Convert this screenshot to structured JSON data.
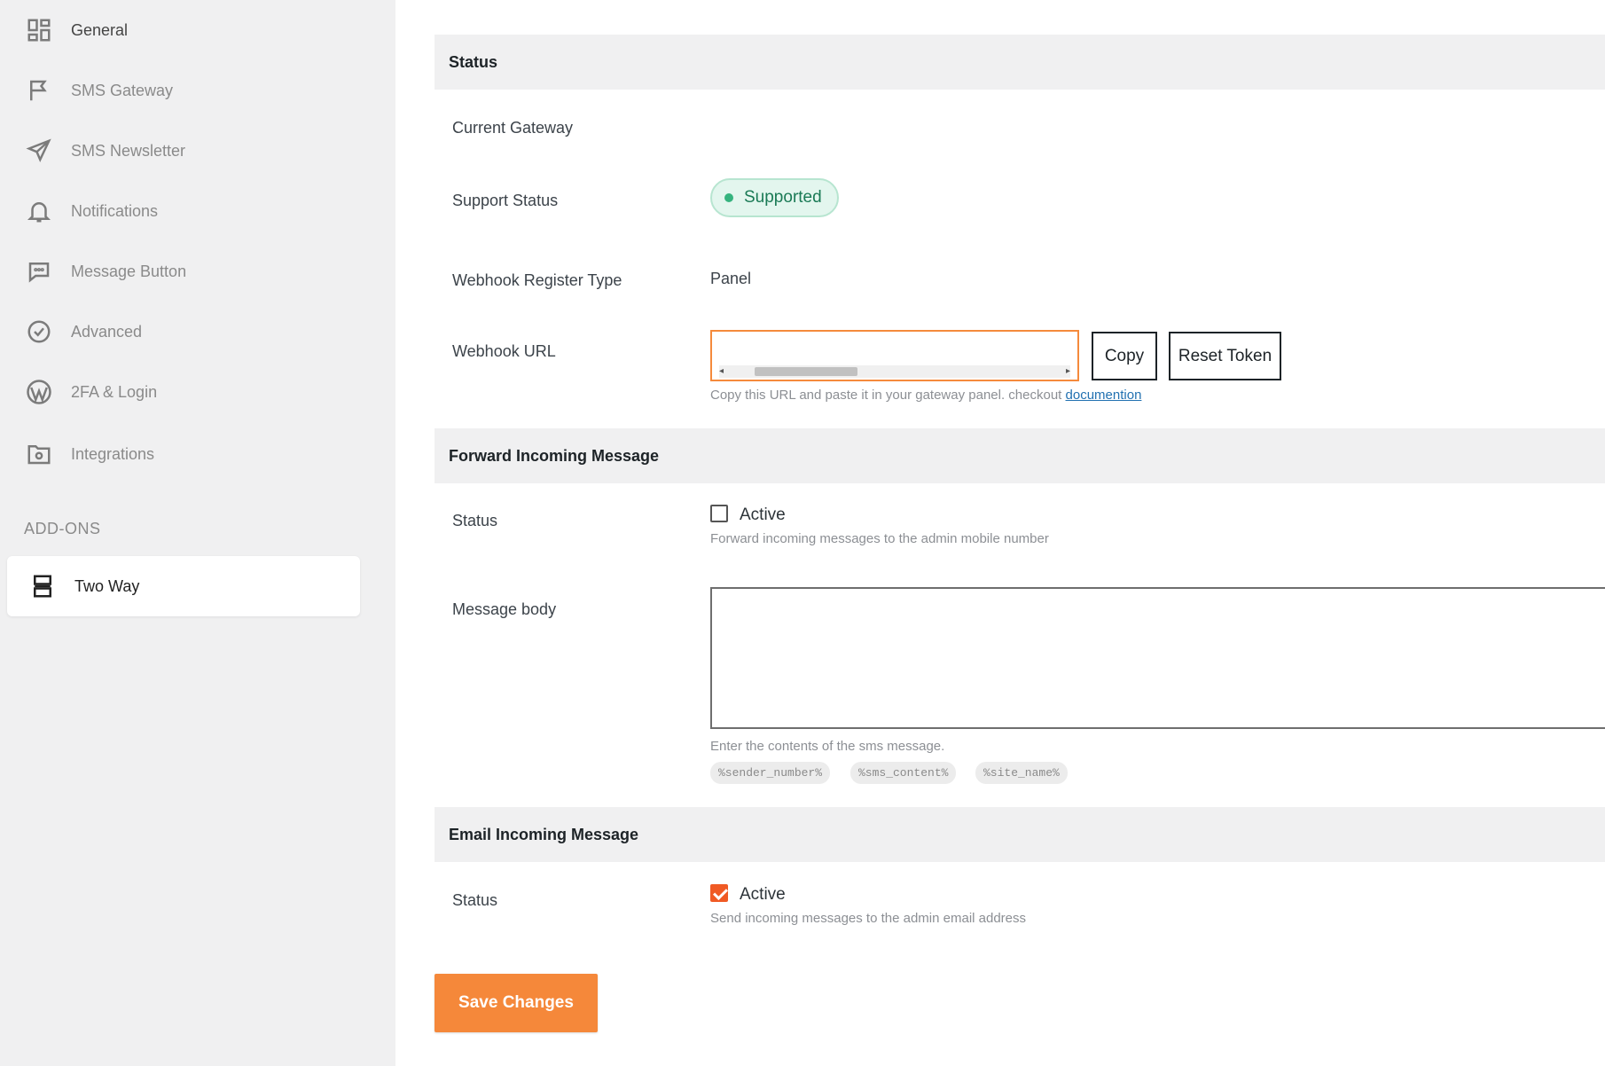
{
  "sidebar": {
    "items": [
      {
        "label": "General",
        "icon": "grid-icon"
      },
      {
        "label": "SMS Gateway",
        "icon": "flag-icon"
      },
      {
        "label": "SMS Newsletter",
        "icon": "paper-plane-icon"
      },
      {
        "label": "Notifications",
        "icon": "bell-icon"
      },
      {
        "label": "Message Button",
        "icon": "chat-bubble-icon"
      },
      {
        "label": "Advanced",
        "icon": "check-badge-icon"
      },
      {
        "label": "2FA & Login",
        "icon": "wordpress-icon"
      },
      {
        "label": "Integrations",
        "icon": "folder-gear-icon"
      }
    ],
    "addons_heading": "ADD-ONS",
    "addon_items": [
      {
        "label": "Two Way",
        "icon": "two-way-icon",
        "active": true
      }
    ]
  },
  "status_section": {
    "heading": "Status",
    "current_gateway_label": "Current Gateway",
    "support_status_label": "Support Status",
    "support_status_value": "Supported",
    "webhook_register_type_label": "Webhook Register Type",
    "webhook_register_type_value": "Panel",
    "webhook_url_label": "Webhook URL",
    "copy_button": "Copy",
    "reset_token_button": "Reset Token",
    "webhook_help_text": "Copy this URL and paste it in your gateway panel. checkout",
    "webhook_help_link": "documention"
  },
  "forward_section": {
    "heading": "Forward Incoming Message",
    "status_label": "Status",
    "active_label": "Active",
    "active_checked": false,
    "status_help": "Forward incoming messages to the admin mobile number",
    "message_body_label": "Message body",
    "message_body_value": "",
    "message_body_help": "Enter the contents of the sms message.",
    "placeholders": [
      "%sender_number%",
      "%sms_content%",
      "%site_name%"
    ]
  },
  "email_section": {
    "heading": "Email Incoming Message",
    "status_label": "Status",
    "active_label": "Active",
    "active_checked": true,
    "status_help": "Send incoming messages to the admin email address"
  },
  "save_button": "Save Changes",
  "colors": {
    "accent": "#f5883a",
    "checkbox_checked": "#f05a24",
    "supported_badge_bg": "#e3f6ee",
    "supported_text": "#1a7a55",
    "link": "#2271b1"
  }
}
